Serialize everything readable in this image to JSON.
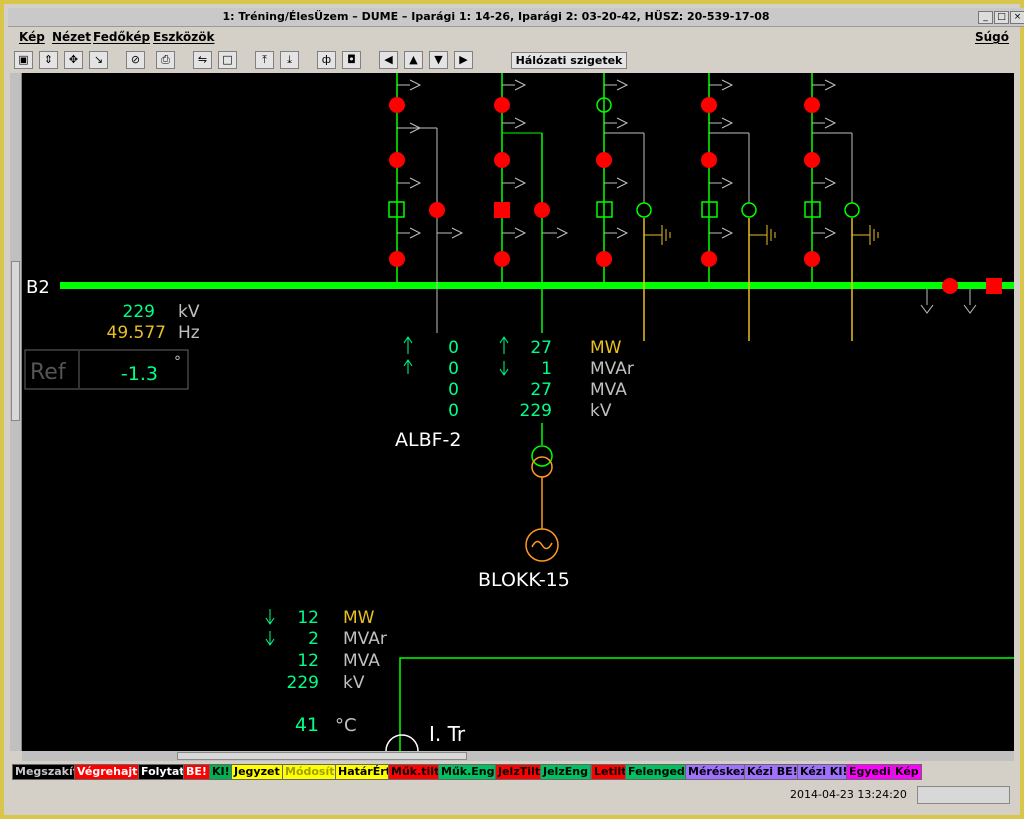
{
  "window": {
    "title": "1: Tréning/ÉlesÜzem – DUME   –   Iparági 1: 14-26, Iparági 2: 03-20-42, HÜSZ: 20-539-17-08",
    "min": "_",
    "max": "□",
    "close": "×"
  },
  "menu": {
    "items": [
      "Kép",
      "Nézet",
      "Fedőkép",
      "Eszközök"
    ],
    "help": "Súgó"
  },
  "toolbar": {
    "network_islands": "Hálózati szigetek"
  },
  "diagram": {
    "bus_label": "B2",
    "bus_kv": "229",
    "bus_kv_unit": "kV",
    "bus_hz": "49.577",
    "bus_hz_unit": "Hz",
    "ref_label": "Ref",
    "ref_value": "-1.3",
    "ref_unit": "°",
    "albf": {
      "name": "ALBF-2",
      "mw": "0",
      "mvar": "0",
      "mva": "0",
      "kv": "0"
    },
    "blokk": {
      "name": "BLOKK-15",
      "mw": "27",
      "mvar": "1",
      "mva": "27",
      "kv": "229"
    },
    "units": {
      "mw": "MW",
      "mvar": "MVAr",
      "mva": "MVA",
      "kv": "kV"
    },
    "tr": {
      "name": "I. Tr",
      "mw": "12",
      "mvar": "2",
      "mva": "12",
      "kv": "229",
      "temp": "41",
      "temp_unit": "°C"
    }
  },
  "command_buttons": [
    {
      "label": "Megszakít",
      "bg": "#000000",
      "fg": "#c8c8c8"
    },
    {
      "label": "Végrehajt",
      "bg": "#ff0000",
      "fg": "#ffffff"
    },
    {
      "label": "Folytat",
      "bg": "#000000",
      "fg": "#ffffff"
    },
    {
      "label": "BE!",
      "bg": "#ff0000",
      "fg": "#ffffff"
    },
    {
      "label": "KI!",
      "bg": "#00b050",
      "fg": "#000000"
    },
    {
      "label": "Jegyzet",
      "bg": "#ffff00",
      "fg": "#000000"
    },
    {
      "label": "Módosít",
      "bg": "#ffff00",
      "fg": "#a0a000"
    },
    {
      "label": "HatárÉrt",
      "bg": "#ffff00",
      "fg": "#000000"
    },
    {
      "label": "Műk.tilt",
      "bg": "#ff0000",
      "fg": "#000000"
    },
    {
      "label": "Műk.Eng",
      "bg": "#00c060",
      "fg": "#000000"
    },
    {
      "label": "JelzTilt",
      "bg": "#ff0000",
      "fg": "#000000"
    },
    {
      "label": "JelzEng",
      "bg": "#00c060",
      "fg": "#000000"
    },
    {
      "label": "Letilt",
      "bg": "#ff0000",
      "fg": "#000000"
    },
    {
      "label": "Felenged",
      "bg": "#00c060",
      "fg": "#000000"
    },
    {
      "label": "Méréskez",
      "bg": "#a070ff",
      "fg": "#000000"
    },
    {
      "label": "Kézi BE!",
      "bg": "#a070ff",
      "fg": "#000000"
    },
    {
      "label": "Kézi KI!",
      "bg": "#a070ff",
      "fg": "#000000"
    },
    {
      "label": "Egyedi",
      "bg": "#ff00ff",
      "fg": "#000000"
    },
    {
      "label": "Kép",
      "bg": "#ff00ff",
      "fg": "#000000"
    }
  ],
  "status": {
    "timestamp": "2014-04-23 13:24:20"
  }
}
